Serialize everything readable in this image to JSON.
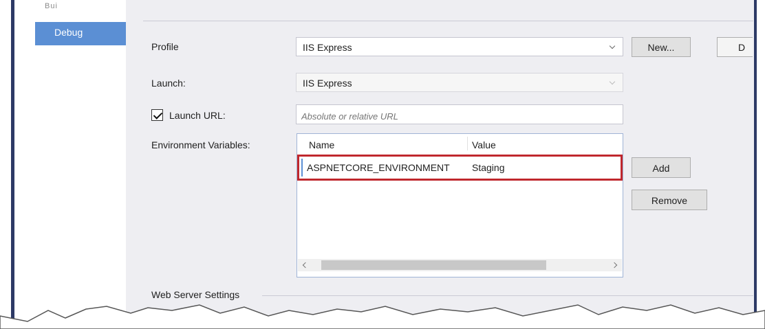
{
  "sidebar": {
    "partial_tab_label": "Bui",
    "active_tab_label": "Debug"
  },
  "profile": {
    "label": "Profile",
    "value": "IIS Express",
    "new_button": "New...",
    "delete_button_partial": "D"
  },
  "launch": {
    "label": "Launch:",
    "value": "IIS Express"
  },
  "launch_url": {
    "label": "Launch URL:",
    "checked": true,
    "placeholder": "Absolute or relative URL"
  },
  "env_vars": {
    "label": "Environment Variables:",
    "columns": [
      "Name",
      "Value"
    ],
    "rows": [
      {
        "name": "ASPNETCORE_ENVIRONMENT",
        "value": "Staging"
      }
    ],
    "add_button": "Add",
    "remove_button": "Remove"
  },
  "web_server": {
    "section_label": "Web Server Settings"
  },
  "colors": {
    "accent": "#5b8fd4",
    "highlight": "#c0272d",
    "panel_bg": "#eeeef2",
    "frame": "#2d3a66"
  }
}
